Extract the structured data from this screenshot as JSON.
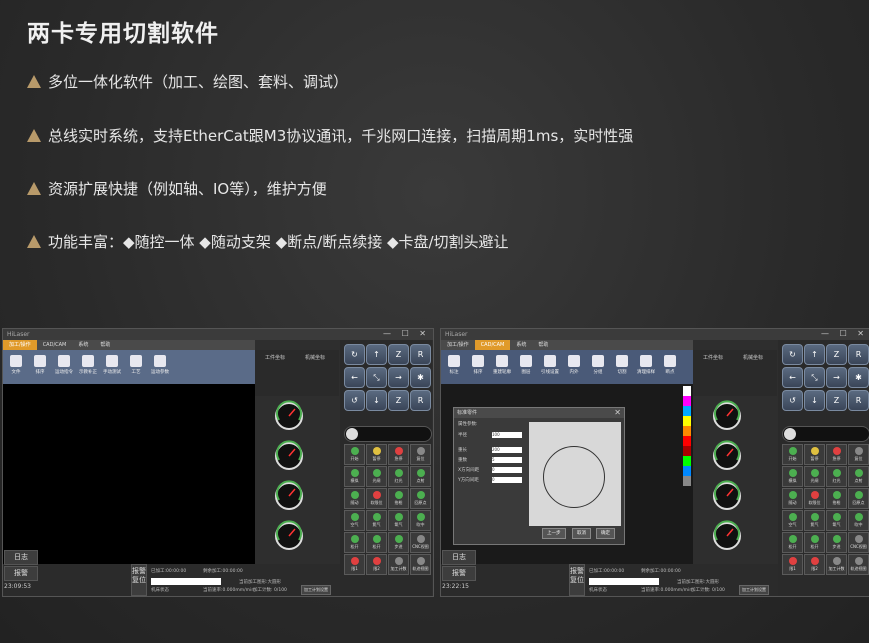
{
  "title": "两卡专用切割软件",
  "bullets": [
    "多位一体化软件（加工、绘图、套料、调试）",
    "总线实时系统，支持EtherCat跟M3协议通讯，千兆网口连接，扫描周期1ms，实时性强",
    "资源扩展快捷（例如轴、IO等），维护方便",
    "功能丰富：◆随控一体   ◆随动支架   ◆断点/断点续接   ◆卡盘/切割头避让"
  ],
  "screens": [
    {
      "app_title": "HiLaser",
      "menu": [
        "加工/操作",
        "CAD/CAM",
        "系统",
        "帮助"
      ],
      "active_menu": 0,
      "toolbar": [
        "文件",
        "排序",
        "运动指令",
        "示教补正",
        "手动测试",
        "工艺",
        "运动参数"
      ],
      "coord_labels": [
        "工件坐标",
        "机械坐标"
      ],
      "log_button": "日志",
      "alarm_button": "报警",
      "time": "23:09:53",
      "alarm_reset": "报警复位",
      "status": {
        "processed": "已加工:00:00:00",
        "remaining": "剩余加工:00:00:00",
        "current": "当前加工图形:大圆形",
        "machine": "机床状态",
        "rate": "当前速率:0.000mm/min",
        "count": "加工计数: 0/100",
        "plan": "加工计划设置"
      }
    },
    {
      "app_title": "HiLaser",
      "menu": [
        "加工/操作",
        "CAD/CAM",
        "系统",
        "帮助"
      ],
      "active_menu": 1,
      "toolbar": [
        "标注",
        "排序",
        "重建轮廓",
        "图层",
        "引线设置",
        "内外",
        "分组",
        "切割",
        "清理排样",
        "断点"
      ],
      "coord_labels": [
        "工件坐标",
        "机械坐标"
      ],
      "dialog": {
        "title": "标准零件",
        "prop": "属性参数:",
        "fields": [
          {
            "label": "半径",
            "value": "100"
          },
          {
            "label": "重长",
            "value": "200"
          },
          {
            "label": "重数",
            "value": "5"
          },
          {
            "label": "X方向间距",
            "value": "0"
          },
          {
            "label": "Y方向间距",
            "value": "0"
          }
        ],
        "buttons": [
          "上一步",
          "取消",
          "确定"
        ]
      },
      "log_button": "日志",
      "alarm_button": "报警",
      "time": "23:22:15",
      "alarm_reset": "报警复位",
      "status": {
        "processed": "已加工:00:00:00",
        "remaining": "剩余加工:00:00:00",
        "current": "当前加工图形:大圆形",
        "machine": "机床状态",
        "rate": "当前速率:0.000mm/min",
        "count": "加工计数: 0/100",
        "plan": "加工计划设置"
      }
    }
  ],
  "right_buttons": [
    "开始",
    "暂停",
    "急停",
    "复位",
    "模拟",
    "光闸",
    "红光",
    "点射",
    "随动",
    "软限位",
    "抬枪",
    "回原点",
    "空气",
    "氮气",
    "氧气",
    "吹中",
    "松开",
    "松开",
    "步进",
    "CNC视图",
    "限1",
    "限2",
    "加工计数",
    "轨迹视图"
  ],
  "colors": {
    "accent": "#e09a2a",
    "bullet": "#b89a6a",
    "toolbar": "#5a6b88"
  }
}
